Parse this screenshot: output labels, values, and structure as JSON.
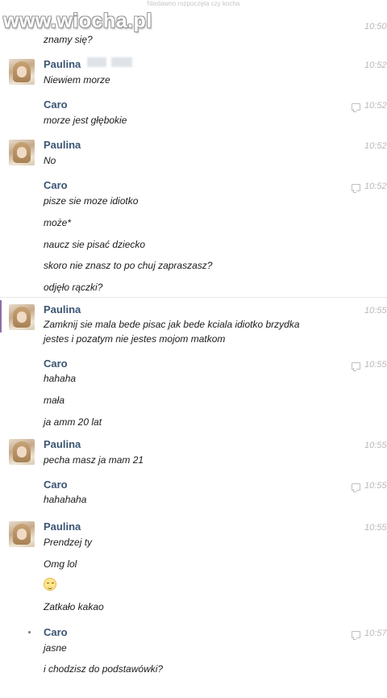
{
  "watermark": "www.wiocha.pl",
  "header_text": "Niedawno rozpoczęta czy kocha",
  "messages": [
    {
      "sender": "",
      "lines": [
        "znamy się?"
      ],
      "time": "10:50"
    },
    {
      "sender": "Paulina",
      "lines": [
        "Niewiem morze"
      ],
      "time": "10:52"
    },
    {
      "sender": "Caro",
      "lines": [
        "morze jest głębokie"
      ],
      "time": "10:52"
    },
    {
      "sender": "Paulina",
      "lines": [
        "No"
      ],
      "time": "10:52"
    },
    {
      "sender": "Caro",
      "lines": [
        "pisze sie moze idiotko",
        "może*",
        "naucz sie pisać dziecko",
        "skoro nie znasz to po chuj zapraszasz?",
        "odjęło rączki?"
      ],
      "time": "10:52"
    },
    {
      "sender": "Paulina",
      "lines": [
        "Zamknij sie mala bede pisac jak bede kciala idiotko brzydka",
        "jestes i pozatym nie jestes mojom matkom"
      ],
      "time": "10:55"
    },
    {
      "sender": "Caro",
      "lines": [
        "hahaha",
        "mała",
        "ja amm 20 lat"
      ],
      "time": "10:55"
    },
    {
      "sender": "Paulina",
      "lines": [
        "pecha masz ja mam 21"
      ],
      "time": "10:55"
    },
    {
      "sender": "Caro",
      "lines": [
        "hahahaha"
      ],
      "time": "10:55"
    },
    {
      "sender": "Paulina",
      "lines": [
        "Prendzej ty",
        "Omg lol",
        "",
        "Zatkało kakao"
      ],
      "time": "10:55"
    },
    {
      "sender": "Caro",
      "lines": [
        "jasne",
        "i chodzisz do podstawówki?"
      ],
      "time": "10:57"
    }
  ]
}
